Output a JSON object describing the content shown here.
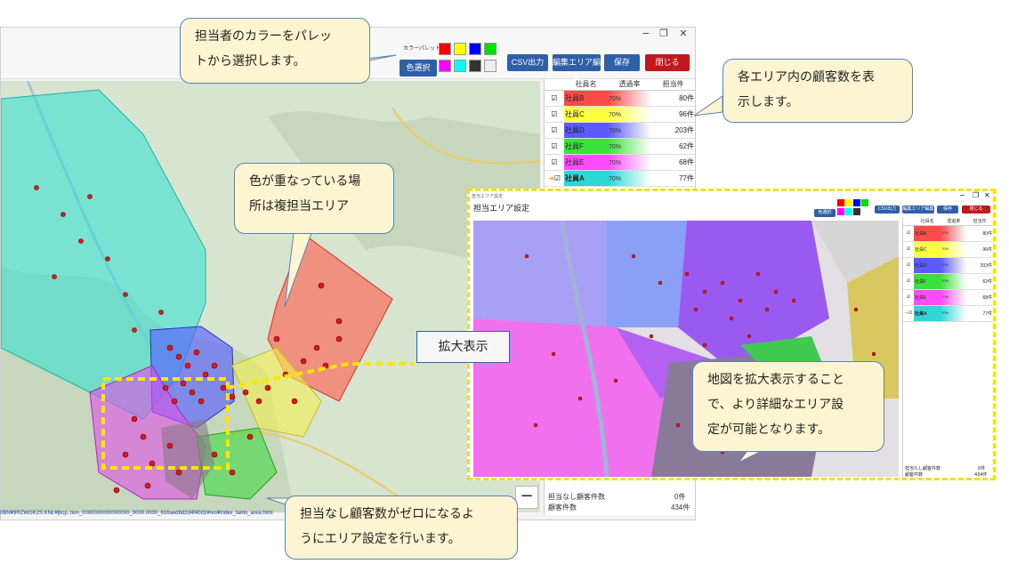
{
  "window": {
    "controls": [
      "−",
      "❐",
      "✕"
    ],
    "palette_label": "カラーパレット",
    "color_select_label": "色選択",
    "csv_label": "CSV出力",
    "edit_area_label": "編集エリア編集",
    "save_label": "保存",
    "close_label": "閉じる",
    "palette_colors": [
      "#ff0000",
      "#ffff00",
      "#0000ff",
      "#00dd00",
      "#ff00ff",
      "#00ffff",
      "#333333",
      "#ffffff"
    ]
  },
  "panel": {
    "headers": [
      "社員名",
      "透過率",
      "担当件"
    ],
    "rows": [
      {
        "name": "社員B",
        "color": "#ff4a4a",
        "transparency": "70%",
        "count": "80件"
      },
      {
        "name": "社員C",
        "color": "#ffff40",
        "transparency": "70%",
        "count": "96件"
      },
      {
        "name": "社員D",
        "color": "#5a5aff",
        "transparency": "70%",
        "count": "203件"
      },
      {
        "name": "社員F",
        "color": "#3ce03c",
        "transparency": "70%",
        "count": "62件"
      },
      {
        "name": "社員E",
        "color": "#ff4aff",
        "transparency": "70%",
        "count": "68件"
      },
      {
        "name": "社員A",
        "color": "#2ed6d6",
        "transparency": "70%",
        "count": "77件"
      }
    ],
    "unassigned_label": "担当なし顧客件数",
    "unassigned_value": "0件",
    "total_label": "顧客件数",
    "total_value": "434件"
  },
  "statusbar": "0BN¥9RZWGK2S.KNL¥jbcp..tion_0000000000000000_0000.0000_616aed8d2d4f40d1¥res¥index_tanto_area.html",
  "map": {
    "zoom_minus": "−"
  },
  "zoom": {
    "title": "担当エリア設定",
    "small_title": "担当エリア設定",
    "controls": [
      "−",
      "❐",
      "✕"
    ],
    "buttons": {
      "color": "色選択",
      "csv": "CSV出力",
      "edit": "編集エリア編集",
      "save": "保存",
      "close": "閉じる"
    },
    "foot_unassigned": "担当なし顧客件数",
    "foot_unassigned_value": "0件",
    "foot_total": "顧客件数",
    "foot_total_value": "434件"
  },
  "callouts": {
    "palette": [
      "担当者のカラーをパレッ",
      "トから選択します。"
    ],
    "count": [
      "各エリア内の顧客数を表",
      "示します。"
    ],
    "overlap": [
      "色が重なっている場",
      "所は複担当エリア"
    ],
    "zoom_label": "拡大表示",
    "detail": [
      "地図を拡大表示すること",
      "で、より詳細なエリア設",
      "定が可能となります。"
    ],
    "unassigned": [
      "担当なし顧客数がゼロになるよ",
      "うにエリア設定を行います。"
    ]
  }
}
